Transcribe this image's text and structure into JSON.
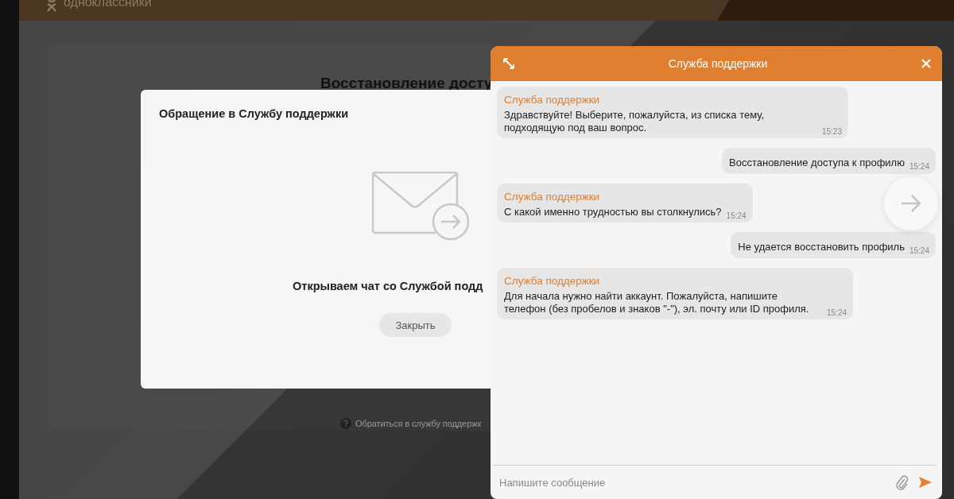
{
  "page": {
    "logo": "одноклассники",
    "title": "Восстановление досту",
    "help_link": "Обратиться в службу поддержк"
  },
  "modal": {
    "title": "Обращение в Службу поддержки",
    "message": "Открываем чат со Службой подд",
    "button": "Закрыть"
  },
  "chat": {
    "title": "Служба поддержки",
    "messages": [
      {
        "kind": "incoming",
        "sender": "Служба поддержки",
        "text": "Здравствуйте! Выберите, пожалуйста, из списка тему, подходящую под ваш вопрос.",
        "time": "15:23"
      },
      {
        "kind": "outgoing",
        "text": "Восстановление доступа к профилю",
        "time": "15:24"
      },
      {
        "kind": "incoming",
        "sender": "Служба поддержки",
        "text": "С какой именно трудностью вы столкнулись?",
        "time": "15:24"
      },
      {
        "kind": "outgoing",
        "text": "Не удается восстановить профиль",
        "time": "15:24"
      },
      {
        "kind": "incoming",
        "sender": "Служба поддержки",
        "text": "Для начала нужно найти аккаунт. Пожалуйста, напишите телефон (без пробелов и знаков \"-\"), эл. почту или ID профиля.",
        "time": "15:24"
      }
    ],
    "input": {
      "placeholder": "Напишите сообщение"
    }
  }
}
